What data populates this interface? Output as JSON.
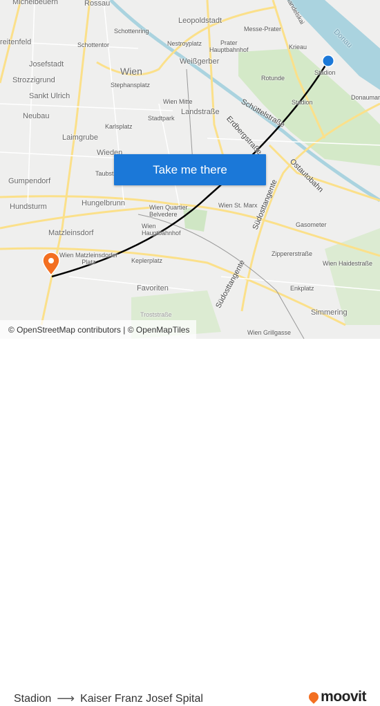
{
  "map": {
    "labels": {
      "michelbeuern": "Michelbeuern",
      "rossau": "Rossau",
      "leopoldstadt": "Leopoldstadt",
      "handelskai": "Handelskai",
      "donau": "Donau",
      "messe_prater": "Messe-Prater",
      "schottenring": "Schottenring",
      "schottentor": "Schottentor",
      "nestroyplatz": "Nestroyplatz",
      "prater_hbf": "Prater\nHauptbahnhof",
      "krieau": "Krieau",
      "stadion_top": "Stadion",
      "breitenfeld": "reitenfeld",
      "josefstadt": "Josefstadt",
      "wien": "Wien",
      "weissgerber": "Weißgerber",
      "strozzigrund": "Strozzigrund",
      "stephansplatz": "Stephansplatz",
      "rotunde": "Rotunde",
      "sankt_ulrich": "Sankt Ulrich",
      "wien_mitte": "Wien Mitte",
      "landstrasse": "Landstraße",
      "stadion_2": "Stadion",
      "donaumarina": "Donaumari",
      "schuettelstrasse": "Schüttelstraße",
      "neubau": "Neubau",
      "karlsplatz": "Karlsplatz",
      "stadtpark": "Stadtpark",
      "erdbergstrasse": "Erdbergstraße",
      "laimgrube": "Laimgrube",
      "wieden": "Wieden",
      "taubst": "Taubst",
      "ostautobahn": "Ostautobahn",
      "gumpendorf": "Gumpendorf",
      "suedosttangente_1": "Südosttangente",
      "hundsturm": "Hundsturm",
      "hungelbrunn": "Hungelbrunn",
      "wien_quartier_belvedere": "Wien Quartier\nBelvedere",
      "wien_st_marx": "Wien St. Marx",
      "gasometer": "Gasometer",
      "matzleinsdorf": "Matzleinsdorf",
      "wien_hbf": "Wien\nHauptbahnhof",
      "wien_matzleinsdorfer_platz": "Wien Matzleinsdorfer\nPlatz",
      "zippererstrasse": "Zippererstraße",
      "keplerplatz": "Keplerplatz",
      "wien_haidestrasse": "Wien Haidestraße",
      "favoriten": "Favoriten",
      "enkplatz": "Enkplatz",
      "suedosttangente_2": "Südosttangente",
      "simmering": "Simmering",
      "troststrasse": "Troststraße",
      "wien_grillgasse": "Wien Grillgasse"
    },
    "cta_label": "Take me there",
    "attribution": "© OpenStreetMap contributors | © OpenMapTiles",
    "colors": {
      "route": "#000000",
      "origin": "#1b78d8",
      "destination": "#f36f21",
      "water": "#aad3df",
      "park": "#cfe6c4",
      "road": "#fbe08a"
    }
  },
  "footer": {
    "origin": "Stadion",
    "arrow": "⟶",
    "destination": "Kaiser Franz Josef Spital",
    "brand": "moovit"
  }
}
